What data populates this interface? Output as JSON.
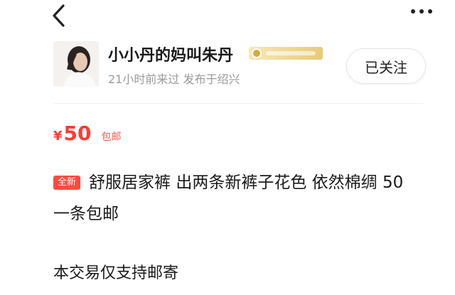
{
  "nav": {
    "back_icon": "chevron-left-icon",
    "more_icon": "more-dots-icon"
  },
  "seller": {
    "name": "小小丹的妈叫朱丹",
    "meta": "21小时前来过 发布于绍兴",
    "follow_label": "已关注",
    "badge_color": "#e9c978"
  },
  "listing": {
    "currency": "¥",
    "price": "50",
    "shipping": "包邮",
    "condition_badge": "全新",
    "description": "舒服居家裤 出两条新裤子花色 依然棉绸 50一条包邮",
    "trade_note": "本交易仅支持邮寄",
    "accent_color": "#ff3b30"
  }
}
